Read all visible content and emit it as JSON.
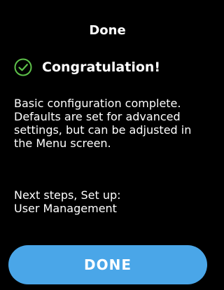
{
  "header": {
    "title": "Done"
  },
  "status": {
    "icon": "check-circle-icon",
    "icon_color": "#5ec24a",
    "heading": "Congratulation!"
  },
  "message": {
    "body": "Basic configuration complete. Defaults are set for advanced settings, but can be adjusted in the Menu screen.",
    "next_steps_label": "Next steps, Set up:",
    "next_steps_item": "User Management"
  },
  "actions": {
    "done_label": "DONE",
    "done_color": "#4aa6e8"
  },
  "colors": {
    "background": "#000000",
    "text": "#ffffff"
  }
}
